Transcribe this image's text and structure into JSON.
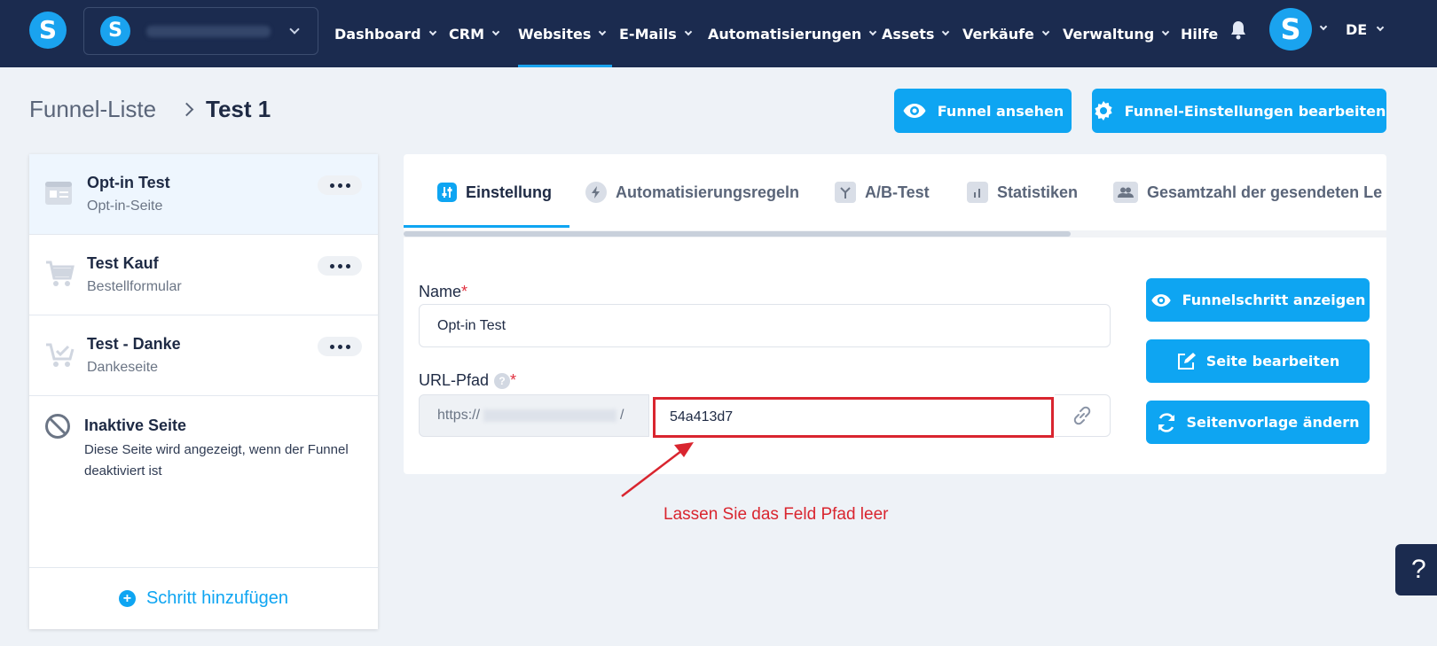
{
  "colors": {
    "nav_bg": "#1b2b4f",
    "accent": "#0ea5f2",
    "annotation": "#d9252f"
  },
  "logo_letter": "S",
  "nav": {
    "items": [
      {
        "label": "Dashboard"
      },
      {
        "label": "CRM"
      },
      {
        "label": "Websites"
      },
      {
        "label": "E-Mails"
      },
      {
        "label": "Automatisierungen"
      },
      {
        "label": "Assets"
      },
      {
        "label": "Verkäufe"
      },
      {
        "label": "Verwaltung"
      },
      {
        "label": "Hilfe"
      }
    ],
    "active": "Websites",
    "user_letter": "S",
    "language": "DE"
  },
  "breadcrumb": {
    "parent": "Funnel-Liste",
    "current": "Test 1"
  },
  "header_buttons": {
    "view": "Funnel ansehen",
    "settings": "Funnel-Einstellungen bearbeiten"
  },
  "steps": [
    {
      "title": "Opt-in Test",
      "subtitle": "Opt-in-Seite",
      "icon": "optin-page-icon"
    },
    {
      "title": "Test Kauf",
      "subtitle": "Bestellformular",
      "icon": "cart-icon"
    },
    {
      "title": "Test - Danke",
      "subtitle": "Dankeseite",
      "icon": "cart-check-icon"
    }
  ],
  "inactive": {
    "title": "Inaktive Seite",
    "description": "Diese Seite wird angezeigt, wenn der Funnel deaktiviert ist"
  },
  "add_step": "Schritt hinzufügen",
  "tabs": [
    {
      "label": "Einstellung"
    },
    {
      "label": "Automatisierungsregeln"
    },
    {
      "label": "A/B-Test"
    },
    {
      "label": "Statistiken"
    },
    {
      "label": "Gesamtzahl der gesendeten Le"
    }
  ],
  "form": {
    "name_label": "Name",
    "name_value": "Opt-in Test",
    "url_label": "URL-Pfad",
    "url_prefix_start": "https://",
    "url_prefix_end": "/",
    "url_slug": "54a413d7",
    "required_mark": "*",
    "help_glyph": "?"
  },
  "side_buttons": {
    "show_step": "Funnelschritt anzeigen",
    "edit_page": "Seite bearbeiten",
    "change_template": "Seitenvorlage ändern"
  },
  "annotation": "Lassen Sie das Feld  Pfad leer",
  "help_fab": "?"
}
